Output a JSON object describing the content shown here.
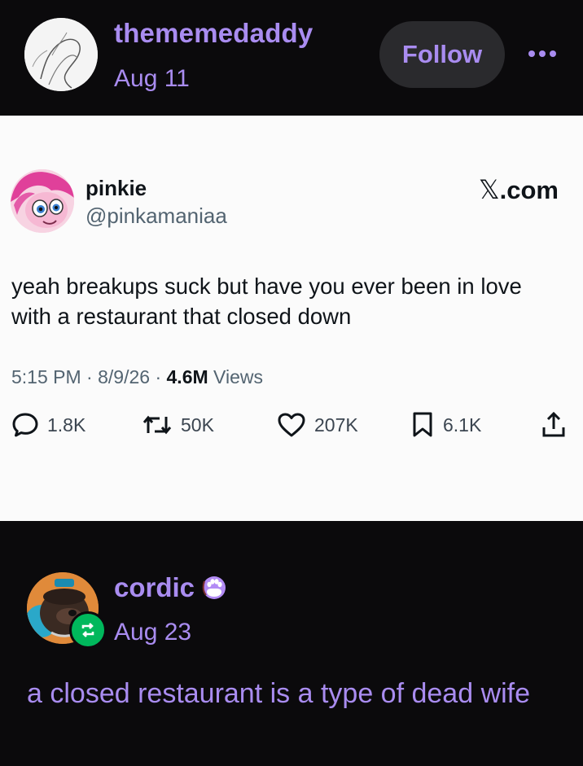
{
  "post": {
    "author": "thememedaddy",
    "date": "Aug 11",
    "follow_label": "Follow",
    "more_label": "•••"
  },
  "tweet": {
    "display_name": "pinkie",
    "handle": "@pinkamaniaa",
    "source": ".com",
    "source_glyph": "𝕏",
    "text": "yeah breakups suck but have you ever been in love with a restaurant that closed down",
    "time": "5:15 PM",
    "date": "8/9/26",
    "views_count": "4.6M",
    "views_label": "Views",
    "sep": "·",
    "replies": "1.8K",
    "retweets": "50K",
    "likes": "207K",
    "bookmarks": "6.1K"
  },
  "reblog": {
    "author": "cordic",
    "date": "Aug 23",
    "text": "a closed restaurant is a type of dead wife"
  },
  "colors": {
    "background": "#0b0a0c",
    "accent": "#a98cf0",
    "follow_button": "#2a2a2d",
    "tweet_bg": "#fbfbfb",
    "reblog_badge": "#00b85c"
  },
  "icons": [
    "more-dots-icon",
    "reply-icon",
    "retweet-icon",
    "like-heart-icon",
    "bookmark-icon",
    "share-icon",
    "reblog-icon",
    "paw-badge-icon"
  ]
}
